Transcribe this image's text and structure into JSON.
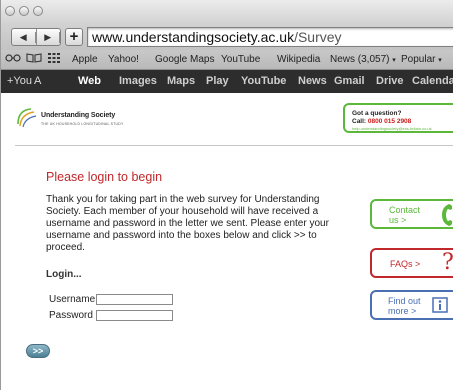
{
  "browser": {
    "url_domain": "www.understandingsociety.ac.uk",
    "url_path": "/Survey",
    "bookmarks": [
      "Apple",
      "Yahoo!",
      "Google Maps",
      "YouTube",
      "Wikipedia",
      "News (3,057)",
      "Popular"
    ],
    "bookmark_icons": [
      "reader-icon",
      "open-book-icon",
      "grid-icon"
    ],
    "google_bar": [
      "+You",
      "A",
      "Web",
      "Images",
      "Maps",
      "Play",
      "YouTube",
      "News",
      "Gmail",
      "Drive",
      "Calendar"
    ],
    "google_bar_active": "Web"
  },
  "header": {
    "logo_name": "Understanding Society",
    "logo_tagline": "THE UK HOUSEHOLD LONGITUDINAL STUDY",
    "question_title": "Got a question?",
    "question_call_prefix": "Call:",
    "question_phone": "0800 015 2908",
    "question_email": "help.understandingsociety@ess-britain.co.uk"
  },
  "main": {
    "heading": "Please login to begin",
    "intro": "Thank you for taking part in the web survey for Understanding Society. Each member of your household will have received a username and password in the letter we sent. Please enter your username and password into the boxes below and click >> to proceed.",
    "login_label": "Login...",
    "username_label": "Username",
    "password_label": "Password",
    "proceed_label": ">>"
  },
  "sidebar": {
    "contact": {
      "line1": "Contact",
      "line2": "us >",
      "icon": "phone-icon"
    },
    "faqs": {
      "label": "FAQs >",
      "icon": "question-mark-icon"
    },
    "findout": {
      "line1": "Find out",
      "line2": "more >",
      "icon": "info-icon"
    }
  },
  "colors": {
    "brand_red": "#c0282b",
    "brand_green": "#5bb83b",
    "brand_blue": "#4a6fb3"
  }
}
